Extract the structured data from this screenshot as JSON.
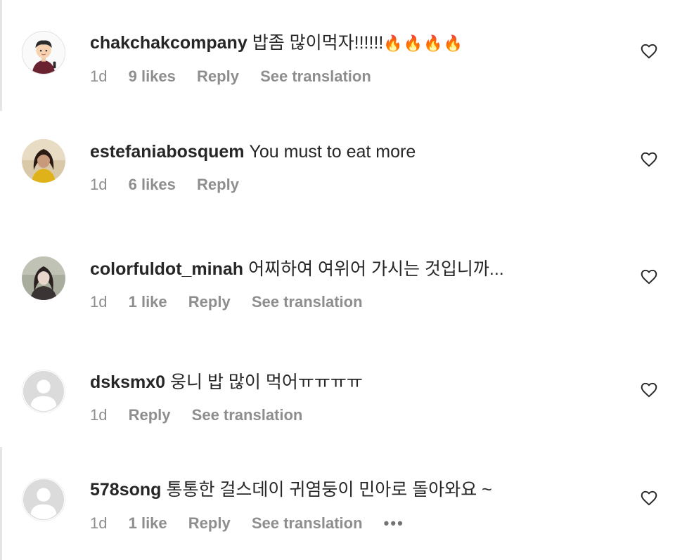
{
  "comments": [
    {
      "username": "chakchakcompany",
      "text": "밥좀 많이먹자!!!!!!",
      "emoji": "🔥🔥🔥🔥",
      "time": "1d",
      "likes": "9 likes",
      "reply": "Reply",
      "translate": "See translation",
      "avatar": "cartoon-avatar"
    },
    {
      "username": "estefaniabosquem",
      "text": "You must to eat more",
      "time": "1d",
      "likes": "6 likes",
      "reply": "Reply",
      "avatar": "photo-avatar"
    },
    {
      "username": "colorfuldot_minah",
      "text": "어찌하여 여위어 가시는 것입니까...",
      "time": "1d",
      "likes": "1 like",
      "reply": "Reply",
      "translate": "See translation",
      "avatar": "photo-avatar"
    },
    {
      "username": "dsksmx0",
      "text": "웅니 밥 많이 먹어ㅠㅠㅠㅠ",
      "time": "1d",
      "reply": "Reply",
      "translate": "See translation",
      "avatar": "default-avatar"
    },
    {
      "username": "578song",
      "text": "통통한 걸스데이 귀염둥이 민아로 돌아와요 ~",
      "time": "1d",
      "likes": "1 like",
      "reply": "Reply",
      "translate": "See translation",
      "more": "•••",
      "avatar": "default-avatar"
    }
  ],
  "icons": {
    "like": "heart-icon",
    "more": "more-options-icon"
  },
  "colors": {
    "text": "#262626",
    "secondary": "#8e8e8e",
    "rule": "#e6e6e6",
    "default_avatar": "#dbdbdb"
  }
}
